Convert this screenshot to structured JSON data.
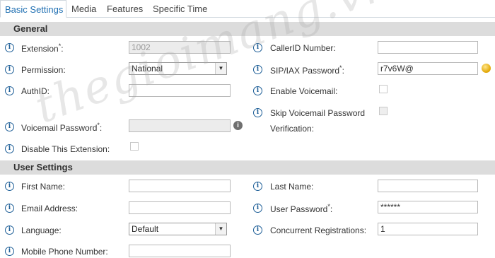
{
  "tabs": [
    "Basic Settings",
    "Media",
    "Features",
    "Specific Time"
  ],
  "sections": {
    "general": "General",
    "user_settings": "User Settings"
  },
  "fields": {
    "extension": {
      "label": "Extension",
      "required": "*",
      "suffix": ":",
      "value": "1002"
    },
    "callerid_number": {
      "label": "CallerID Number:",
      "value": ""
    },
    "permission": {
      "label": "Permission:",
      "value": "National"
    },
    "sip_iax_password": {
      "label": "SIP/IAX Password",
      "required": "*",
      "suffix": ":",
      "value": "r7v6W@"
    },
    "authid": {
      "label": "AuthID:",
      "value": ""
    },
    "enable_voicemail": {
      "label": "Enable Voicemail:"
    },
    "skip_voicemail_password": {
      "label": "Skip Voicemail Password",
      "label2": "Verification:"
    },
    "voicemail_password": {
      "label": "Voicemail Password",
      "required": "*",
      "suffix": ":",
      "value": ""
    },
    "disable_extension": {
      "label": "Disable This Extension:"
    },
    "first_name": {
      "label": "First Name:",
      "value": ""
    },
    "last_name": {
      "label": "Last Name:",
      "value": ""
    },
    "email_address": {
      "label": "Email Address:",
      "value": ""
    },
    "user_password": {
      "label": "User Password",
      "required": "*",
      "suffix": ":",
      "value": "******"
    },
    "language": {
      "label": "Language:",
      "value": "Default"
    },
    "concurrent_registrations": {
      "label": "Concurrent Registrations:",
      "value": "1"
    },
    "mobile_phone": {
      "label": "Mobile Phone Number:",
      "value": ""
    }
  },
  "icons": {
    "info": "i",
    "select_arrow": "▼"
  },
  "watermark": "thegioimang.vn"
}
